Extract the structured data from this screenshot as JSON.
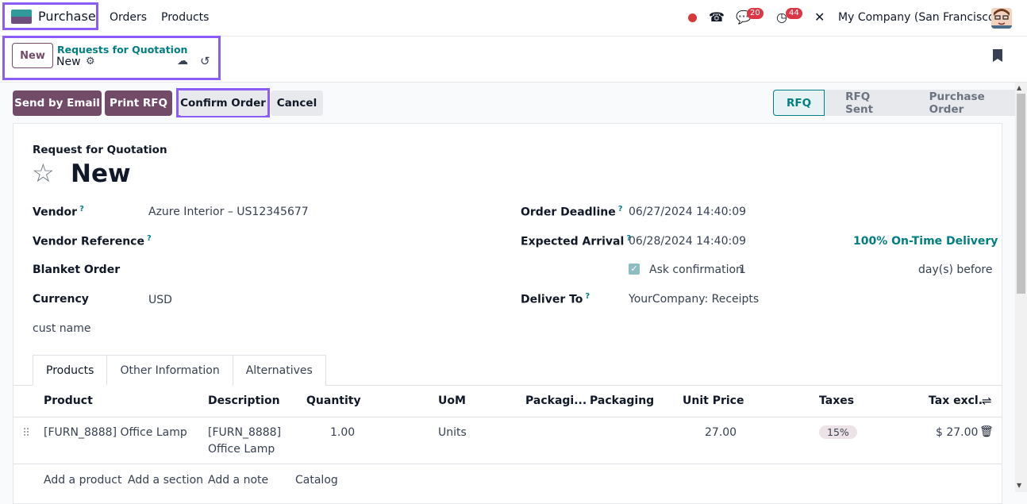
{
  "navbar": {
    "app_name": "Purchase",
    "menu": [
      "Orders",
      "Products"
    ],
    "messages_count": "20",
    "activities_count": "44",
    "company": "My Company (San Francisco)",
    "icons": [
      "record-dot-icon",
      "phone-icon",
      "chat-icon",
      "clock-icon",
      "tools-icon",
      "avatar"
    ]
  },
  "control_panel": {
    "new_label": "New",
    "breadcrumb_parent": "Requests for Quotation",
    "breadcrumb_current": "New"
  },
  "actions": {
    "send_email": "Send by Email",
    "print_rfq": "Print RFQ",
    "confirm_order": "Confirm Order",
    "cancel": "Cancel"
  },
  "statusbar": {
    "stages": [
      "RFQ",
      "RFQ Sent",
      "Purchase Order"
    ],
    "active": "RFQ"
  },
  "form": {
    "title_label": "Request for Quotation",
    "title": "New",
    "left": {
      "vendor_label": "Vendor",
      "vendor_value": "Azure Interior – US12345677",
      "vendor_ref_label": "Vendor Reference",
      "blanket_label": "Blanket Order",
      "currency_label": "Currency",
      "currency_value": "USD",
      "cust_name_label": "cust name"
    },
    "right": {
      "deadline_label": "Order Deadline",
      "deadline_value": "06/27/2024 14:40:09",
      "arrival_label": "Expected Arrival",
      "arrival_value": "06/28/2024 14:40:09",
      "on_time": "100% On-Time Delivery",
      "ask_confirm_label": "Ask confirmation",
      "ask_confirm_days": "1",
      "days_before": "day(s) before",
      "deliver_label": "Deliver To",
      "deliver_value": "YourCompany: Receipts"
    }
  },
  "tabs": [
    "Products",
    "Other Information",
    "Alternatives"
  ],
  "table": {
    "headers": [
      "Product",
      "Description",
      "Quantity",
      "UoM",
      "Packagi...",
      "Packaging",
      "Unit Price",
      "Taxes",
      "Tax excl."
    ],
    "rows": [
      {
        "product": "[FURN_8888] Office Lamp",
        "description_1": "[FURN_8888]",
        "description_2": "Office Lamp",
        "quantity": "1.00",
        "uom": "Units",
        "unit_price": "27.00",
        "tax": "15%",
        "subtotal": "$ 27.00"
      }
    ],
    "footer_links": [
      "Add a product",
      "Add a section",
      "Add a note",
      "Catalog"
    ]
  }
}
